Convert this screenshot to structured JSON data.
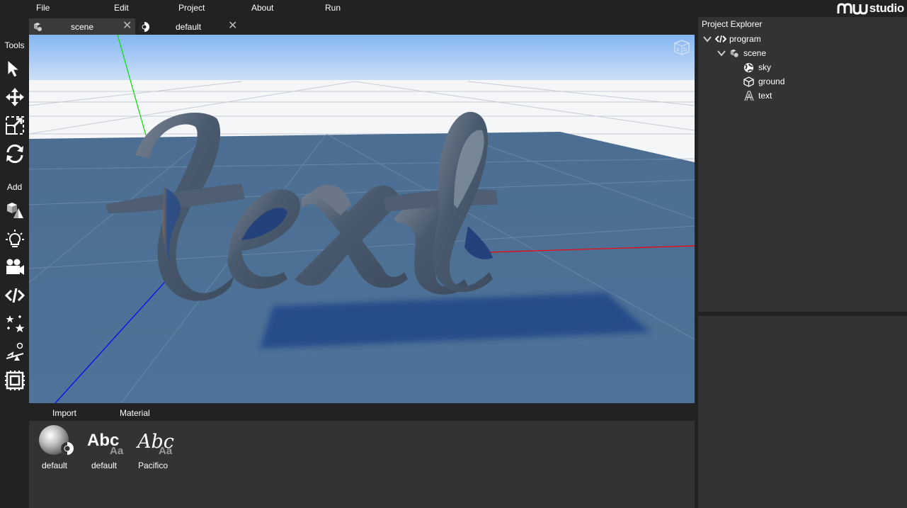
{
  "menu": {
    "file": "File",
    "edit": "Edit",
    "project": "Project",
    "about": "About",
    "run": "Run"
  },
  "brand": {
    "text": "studio"
  },
  "toolbar": {
    "tools_heading": "Tools",
    "add_heading": "Add",
    "tools": [
      "select-arrow-icon",
      "move-icon",
      "scale-icon",
      "rotate-icon"
    ],
    "add_items": [
      "model-icon",
      "light-icon",
      "camera-icon",
      "script-icon",
      "particles-icon",
      "physics-icon",
      "chip-icon"
    ]
  },
  "tabs": [
    {
      "label": "scene",
      "icon": "scene-icon",
      "active": true
    },
    {
      "label": "default",
      "icon": "material-icon",
      "active": false
    }
  ],
  "viewport": {
    "scene_text": "text",
    "view_mode_icon": "3d-view-icon",
    "colors": {
      "sky_top": "#7fb3f0",
      "sky_horizon": "#ffffff",
      "ground": "#4f7194",
      "axis_x": "#ff0000",
      "axis_y": "#00dd00",
      "axis_z": "#0000ff",
      "text_mesh": "#4a5a6e"
    }
  },
  "asset_tabs": {
    "import": "Import",
    "material": "Material"
  },
  "assets": [
    {
      "label": "default",
      "icon": "material-sphere-icon"
    },
    {
      "label": "default",
      "icon": "font-abc-icon",
      "preview": "Abc",
      "sub": "Aa"
    },
    {
      "label": "Pacifico",
      "icon": "font-script-icon",
      "preview": "Abc",
      "sub": "Aa"
    }
  ],
  "explorer": {
    "title": "Project Explorer",
    "tree": [
      {
        "label": "program",
        "icon": "code-icon",
        "expanded": true
      },
      {
        "label": "scene",
        "icon": "scene-icon",
        "expanded": true
      },
      {
        "label": "sky",
        "icon": "globe-icon"
      },
      {
        "label": "ground",
        "icon": "cube-icon"
      },
      {
        "label": "text",
        "icon": "text-mesh-icon"
      }
    ]
  }
}
